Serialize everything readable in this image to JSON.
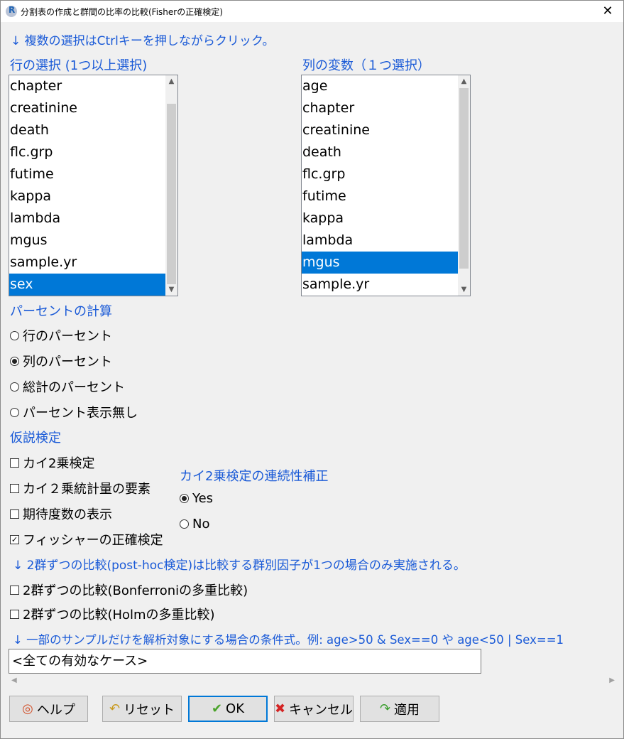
{
  "window": {
    "title": "分割表の作成と群間の比率の比較(Fisherの正確検定)",
    "close_label": "✕"
  },
  "instructions": {
    "multi_select": "↓ 複数の選択はCtrlキーを押しながらクリック。",
    "posthoc_note": "↓ 2群ずつの比較(post-hoc検定)は比較する群別因子が1つの場合のみ実施される。",
    "subset_note": "↓ 一部のサンプルだけを解析対象にする場合の条件式。例: age>50 & Sex==0 や age<50 | Sex==1"
  },
  "row_select": {
    "label": "行の選択 (1つ以上選択)",
    "items": [
      "chapter",
      "creatinine",
      "death",
      "flc.grp",
      "futime",
      "kappa",
      "lambda",
      "mgus",
      "sample.yr",
      "sex"
    ],
    "selected": "sex"
  },
  "col_select": {
    "label": "列の変数（１つ選択）",
    "items": [
      "age",
      "chapter",
      "creatinine",
      "death",
      "flc.grp",
      "futime",
      "kappa",
      "lambda",
      "mgus",
      "sample.yr"
    ],
    "selected": "mgus"
  },
  "percent": {
    "label": "パーセントの計算",
    "options": [
      "行のパーセント",
      "列のパーセント",
      "総計のパーセント",
      "パーセント表示無し"
    ],
    "selected": "列のパーセント"
  },
  "tests": {
    "label": "仮説検定",
    "options": [
      {
        "label": "カイ2乗検定",
        "checked": false
      },
      {
        "label": "カイ２乗統計量の要素",
        "checked": false
      },
      {
        "label": "期待度数の表示",
        "checked": false
      },
      {
        "label": "フィッシャーの正確検定",
        "checked": true
      }
    ]
  },
  "continuity": {
    "label": "カイ2乗検定の連続性補正",
    "options": [
      "Yes",
      "No"
    ],
    "selected": "Yes"
  },
  "posthoc": {
    "options": [
      {
        "label": "2群ずつの比較(Bonferroniの多重比較)",
        "checked": false
      },
      {
        "label": "2群ずつの比較(Holmの多重比較)",
        "checked": false
      }
    ]
  },
  "subset": {
    "value": "<全ての有効なケース>"
  },
  "buttons": {
    "help": "ヘルプ",
    "reset": "リセット",
    "ok": "OK",
    "cancel": "キャンセル",
    "apply": "適用"
  },
  "colors": {
    "accent": "#1a5ad7",
    "selection": "#0078d7"
  }
}
